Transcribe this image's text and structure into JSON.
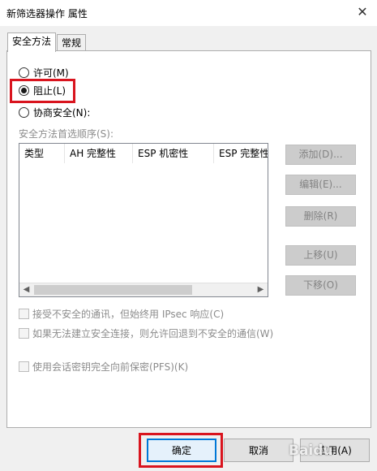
{
  "window": {
    "title": "新筛选器操作 属性",
    "close_glyph": "✕"
  },
  "tabs": [
    {
      "label": "安全方法",
      "active": true
    },
    {
      "label": "常规",
      "active": false
    }
  ],
  "security_options": [
    {
      "label": "许可(M)",
      "checked": false
    },
    {
      "label": "阻止(L)",
      "checked": true
    },
    {
      "label": "协商安全(N):",
      "checked": false
    }
  ],
  "methods_list": {
    "label": "安全方法首选顺序(S):",
    "columns": [
      "类型",
      "AH 完整性",
      "ESP 机密性",
      "ESP 完整性"
    ],
    "rows": []
  },
  "side_buttons": {
    "add": "添加(D)...",
    "edit": "编辑(E)...",
    "remove": "删除(R)",
    "move_up": "上移(U)",
    "move_down": "下移(O)"
  },
  "checkboxes": [
    {
      "label": "接受不安全的通讯，但始终用 IPsec 响应(C)",
      "checked": false
    },
    {
      "label": "如果无法建立安全连接，则允许回退到不安全的通信(W)",
      "checked": false
    },
    {
      "label": "使用会话密钥完全向前保密(PFS)(K)",
      "checked": false
    }
  ],
  "footer": {
    "ok": "确定",
    "cancel": "取消",
    "apply": "应用(A)"
  },
  "watermark": "Baidu",
  "colors": {
    "highlight": "#d9141e",
    "default_button_border": "#0078d7"
  }
}
